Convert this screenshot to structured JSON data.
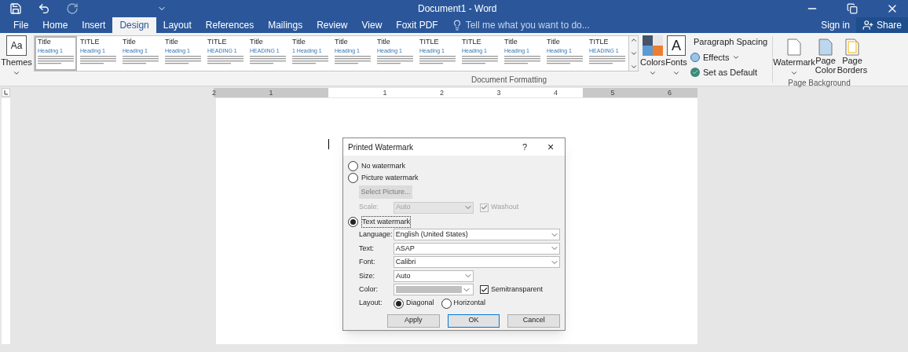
{
  "title_bar": {
    "title": "Document1 - Word"
  },
  "tabs": [
    {
      "label": "File",
      "selected": false
    },
    {
      "label": "Home",
      "selected": false
    },
    {
      "label": "Insert",
      "selected": false
    },
    {
      "label": "Design",
      "selected": true
    },
    {
      "label": "Layout",
      "selected": false
    },
    {
      "label": "References",
      "selected": false
    },
    {
      "label": "Mailings",
      "selected": false
    },
    {
      "label": "Review",
      "selected": false
    },
    {
      "label": "View",
      "selected": false
    },
    {
      "label": "Foxit PDF",
      "selected": false
    }
  ],
  "tell_me": {
    "placeholder": "Tell me what you want to do..."
  },
  "sign_in": "Sign in",
  "share": "Share",
  "ribbon": {
    "themes": "Themes",
    "themes_glyph": "Aa",
    "styles": [
      {
        "title": "Title",
        "heading": "Heading 1",
        "selected": true
      },
      {
        "title": "TITLE",
        "heading": "Heading 1",
        "selected": false
      },
      {
        "title": "Title",
        "heading": "Heading 1",
        "selected": false
      },
      {
        "title": "Title",
        "heading": "Heading 1",
        "selected": false
      },
      {
        "title": "TITLE",
        "heading": "HEADING 1",
        "selected": false
      },
      {
        "title": "Title",
        "heading": "HEADING 1",
        "selected": false
      },
      {
        "title": "Title",
        "heading": "1 Heading 1",
        "selected": false
      },
      {
        "title": "Title",
        "heading": "Heading 1",
        "selected": false
      },
      {
        "title": "Title",
        "heading": "Heading 1",
        "selected": false
      },
      {
        "title": "TITLE",
        "heading": "Heading 1",
        "selected": false
      },
      {
        "title": "TITLE",
        "heading": "Heading 1",
        "selected": false
      },
      {
        "title": "Title",
        "heading": "Heading 1",
        "selected": false
      },
      {
        "title": "Title",
        "heading": "Heading 1",
        "selected": false
      },
      {
        "title": "TITLE",
        "heading": "HEADING 1",
        "selected": false
      }
    ],
    "document_formatting": "Document Formatting",
    "colors": "Colors",
    "fonts": "Fonts",
    "fonts_glyph": "A",
    "paragraph_spacing": "Paragraph Spacing",
    "effects": "Effects",
    "set_as_default": "Set as Default",
    "watermark": "Watermark",
    "page_color": "Page Color",
    "page_borders": "Page Borders",
    "page_background": "Page Background"
  },
  "ruler": {
    "numbers": [
      "2",
      "1",
      "1",
      "2",
      "3",
      "4",
      "5",
      "6"
    ]
  },
  "dialog": {
    "title": "Printed Watermark",
    "help": "?",
    "close": "×",
    "options": [
      {
        "label": "No watermark",
        "selected": false
      },
      {
        "label": "Picture watermark",
        "selected": false
      },
      {
        "label": "Text watermark",
        "selected": true
      }
    ],
    "select_picture": {
      "label": "Select Picture...",
      "disabled": true
    },
    "scale": {
      "label": "Scale:",
      "value": "Auto",
      "disabled": true
    },
    "washout": {
      "label": "Washout",
      "checked": true,
      "disabled": true
    },
    "fields": [
      {
        "kind": "wide",
        "label": "Language:",
        "value": "English (United States)"
      },
      {
        "kind": "wide",
        "label": "Text:",
        "value": "ASAP"
      },
      {
        "kind": "wide",
        "label": "Font:",
        "value": "Calibri"
      },
      {
        "kind": "short",
        "label": "Size:",
        "value": "Auto"
      },
      {
        "kind": "color",
        "label": "Color:"
      }
    ],
    "semitransparent": {
      "label": "Semitransparent",
      "checked": true
    },
    "layout": {
      "label": "Layout:",
      "options": [
        {
          "label": "Diagonal",
          "selected": true
        },
        {
          "label": "Horizontal",
          "selected": false
        }
      ]
    },
    "buttons": [
      "Apply",
      "OK",
      "Cancel"
    ]
  }
}
